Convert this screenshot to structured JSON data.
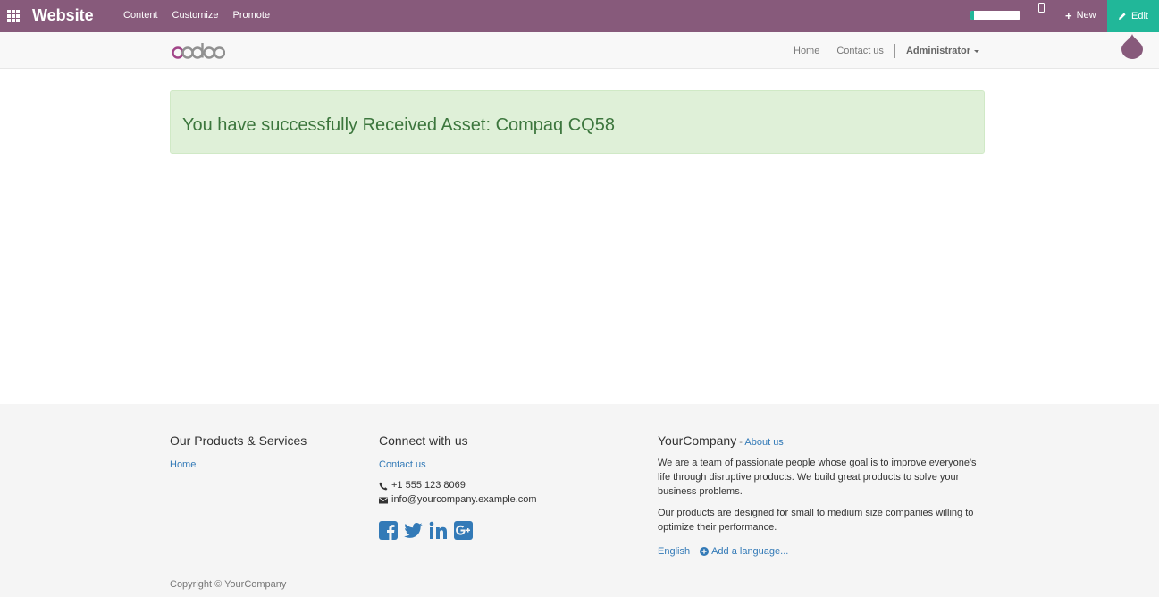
{
  "admin_bar": {
    "app_title": "Website",
    "menu": [
      "Content",
      "Customize",
      "Promote"
    ],
    "progress_fraction": 0.07,
    "new_label": "New",
    "edit_label": "Edit",
    "colors": {
      "bar": "#875a7b",
      "edit": "#21b799"
    }
  },
  "navbar": {
    "logo_text": "odoo",
    "links": {
      "home": "Home",
      "contact": "Contact us"
    },
    "user": "Administrator"
  },
  "alert": {
    "message": "You have successfully Received Asset: Compaq CQ58",
    "color": "#3c763d"
  },
  "footer": {
    "products": {
      "heading": "Our Products & Services",
      "home_link": "Home"
    },
    "connect": {
      "heading": "Connect with us",
      "contact_link": "Contact us",
      "phone": "+1 555 123 8069",
      "email": "info@yourcompany.example.com",
      "social_icons": [
        "facebook-icon",
        "twitter-icon",
        "linkedin-icon",
        "google-plus-icon"
      ]
    },
    "company": {
      "name": "YourCompany",
      "about_prefix": " - ",
      "about_link": "About us",
      "para1": "We are a team of passionate people whose goal is to improve everyone's life through disruptive products. We build great products to solve your business problems.",
      "para2": "Our products are designed for small to medium size companies willing to optimize their performance.",
      "language": "English",
      "add_language": "Add a language..."
    },
    "copyright": "Copyright © YourCompany"
  }
}
